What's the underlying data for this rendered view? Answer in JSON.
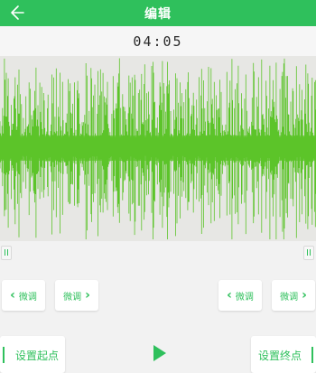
{
  "header": {
    "title": "编辑",
    "back_icon": "arrow-left-icon"
  },
  "time_display": "04:05",
  "waveform": {
    "color": "#5cc42a",
    "background": "#e7e7e4"
  },
  "adjust_buttons": {
    "start_left": "微调",
    "start_right": "微调",
    "end_left": "微调",
    "end_right": "微调"
  },
  "bottom": {
    "set_start_label": "设置起点",
    "play_icon": "play-icon",
    "set_end_label": "设置终点"
  },
  "colors": {
    "accent": "#2fc05c"
  }
}
